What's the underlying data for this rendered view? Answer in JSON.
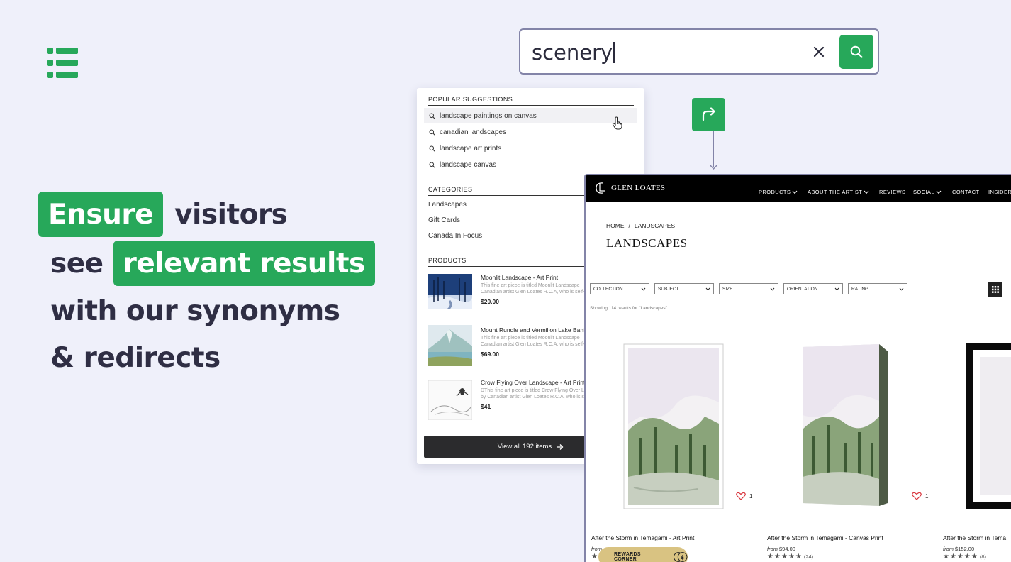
{
  "brand_color": "#27a85a",
  "headline": {
    "pill1": "Ensure",
    "line1_rest": "visitors",
    "line2_lead": "see",
    "pill2": "relevant results",
    "line3": "with our synonyms",
    "line4": "& redirects"
  },
  "search": {
    "value": "scenery",
    "clear_icon": "close-icon",
    "submit_icon": "search-icon"
  },
  "dropdown": {
    "popular_title": "POPULAR SUGGESTIONS",
    "suggestions": [
      "landscape paintings on canvas",
      "canadian landscapes",
      "landscape art prints",
      "landscape canvas"
    ],
    "categories_title": "CATEGORIES",
    "categories": [
      "Landscapes",
      "Gift Cards",
      "Canada In Focus"
    ],
    "products_title": "PRODUCTS",
    "products": [
      {
        "name": "Moonlit Landscape - Art Print",
        "desc1": "This fine art piece is titled Moonlit Landscape",
        "desc2": "Canadian artist Glen Loates R.C.A, who is self-",
        "price": "$20.00"
      },
      {
        "name": "Mount Rundle and Vermilion Lake Banff",
        "desc1": "This fine art piece is titled Moonlit Landscape",
        "desc2": "Canadian artist Glen Loates R.C.A, who is self-",
        "price": "$69.00"
      },
      {
        "name": "Crow Flying Over Landscape - Art Print",
        "desc1": "DThis fine art piece is titled Crow Flying Over L",
        "desc2": "by Canadian artist Glen Loates R.C.A, who is se",
        "price": "$41"
      }
    ],
    "view_all": "View all 192 items"
  },
  "site": {
    "brand": "GLEN LOATES",
    "nav": [
      "PRODUCTS",
      "ABOUT THE ARTIST",
      "REVIEWS",
      "SOCIAL",
      "CONTACT",
      "INSIDER"
    ],
    "breadcrumb_home": "HOME",
    "breadcrumb_sep": "/",
    "breadcrumb_current": "LANDSCAPES",
    "title": "LANDSCAPES",
    "filters": [
      "COLLECTION",
      "SUBJECT",
      "SIZE",
      "ORIENTATION",
      "RATING"
    ],
    "showing": "Showing 114 results for \"Landscapes\"",
    "cards": [
      {
        "title": "After the Storm in Temagami - Art Print",
        "from": "from",
        "price": "",
        "likes": "1",
        "reviews": ""
      },
      {
        "title": "After the Storm in Temagami - Canvas Print",
        "from": "from",
        "price": "$94.00",
        "likes": "1",
        "reviews": "(24)"
      },
      {
        "title": "After the Storm in Tema",
        "from": "from",
        "price": "$152.00",
        "likes": "",
        "reviews": "(8)"
      }
    ],
    "rewards": "REWARDS CORNER"
  }
}
